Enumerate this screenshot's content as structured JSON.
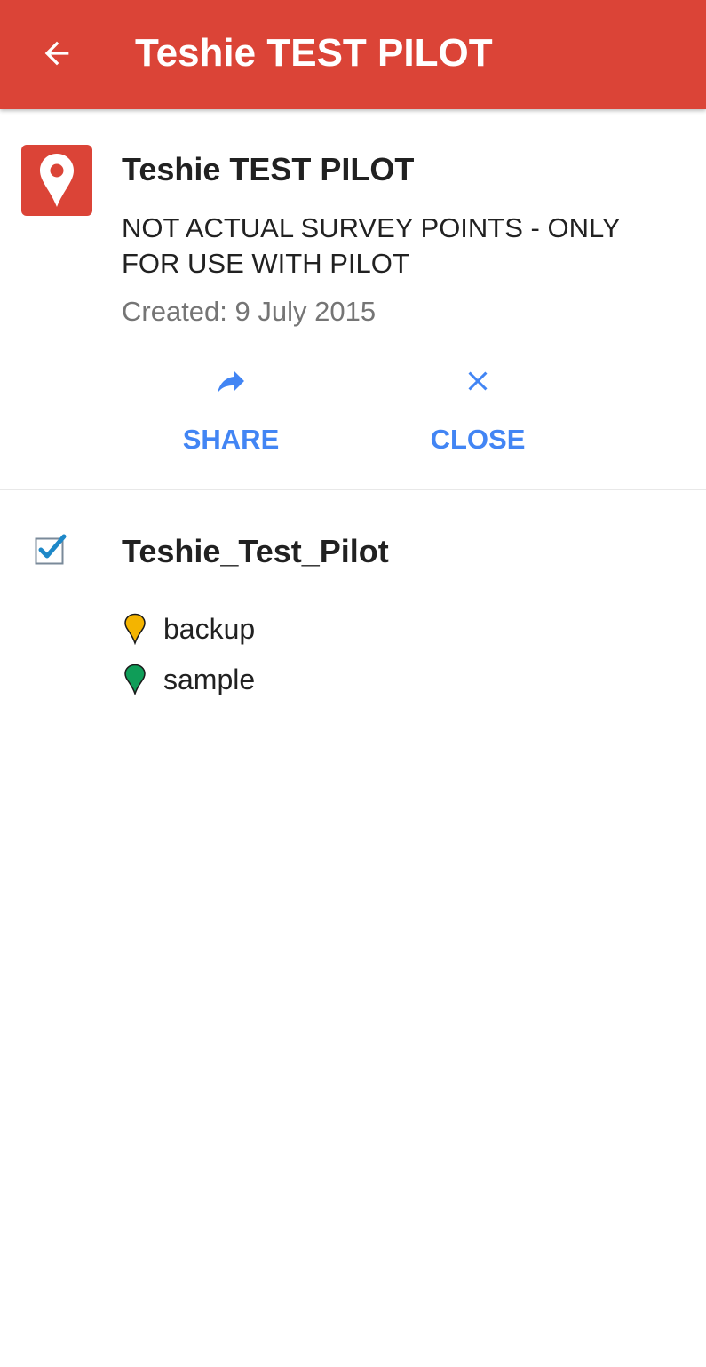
{
  "appbar": {
    "title": "Teshie TEST PILOT",
    "back_icon": "arrow-back-icon",
    "background_color": "#db4437"
  },
  "map": {
    "icon": "map-pin-icon",
    "title": "Teshie TEST PILOT",
    "description": "NOT ACTUAL SURVEY POINTS - ONLY FOR USE WITH PILOT",
    "created": "Created: 9 July 2015"
  },
  "actions": {
    "share": {
      "label": "SHARE",
      "icon": "share-icon"
    },
    "close": {
      "label": "CLOSE",
      "icon": "close-icon"
    },
    "color": "#4285f4"
  },
  "layer": {
    "name": "Teshie_Test_Pilot",
    "checked": true,
    "legend": [
      {
        "label": "backup",
        "icon": "marker-pin-icon",
        "color": "#f4b400"
      },
      {
        "label": "sample",
        "icon": "marker-pin-icon",
        "color": "#0f9d58"
      }
    ]
  }
}
